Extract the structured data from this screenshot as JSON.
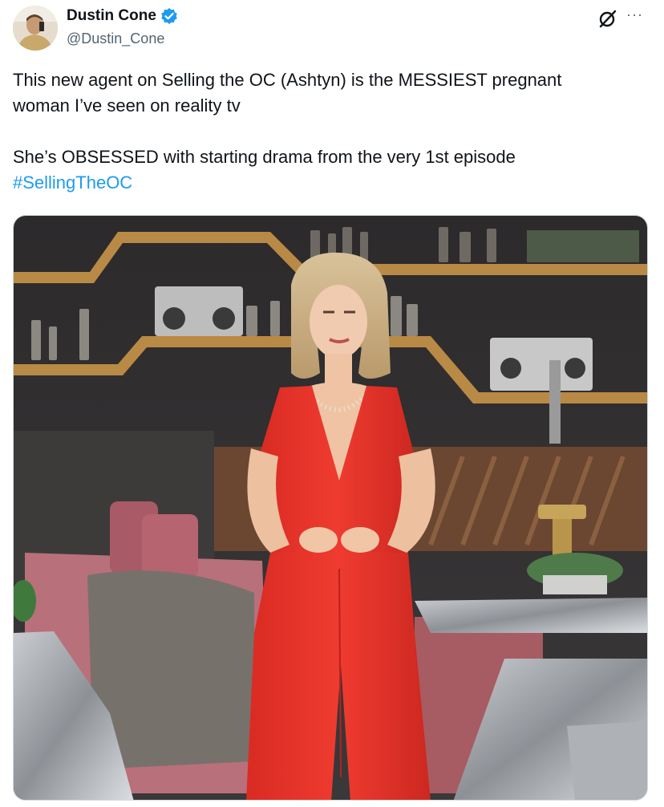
{
  "author": {
    "name": "Dustin Cone",
    "handle": "@Dustin_Cone",
    "verified": true,
    "verified_color": "#1d9bf0"
  },
  "header_icons": {
    "grok": "grok-icon",
    "more": "more-icon",
    "more_glyph": "···"
  },
  "post": {
    "lines": [
      "This new agent on Selling the OC (Ashtyn) is the MESSIEST pregnant",
      "woman I’ve seen on reality tv",
      "She’s OBSESSED with starting drama from the very 1st episode"
    ],
    "hashtag": "#SellingTheOC",
    "hashtag_color": "#1d9bf0"
  },
  "media": {
    "description_icon": "photo-icon",
    "dress_color": "#e8342a"
  }
}
